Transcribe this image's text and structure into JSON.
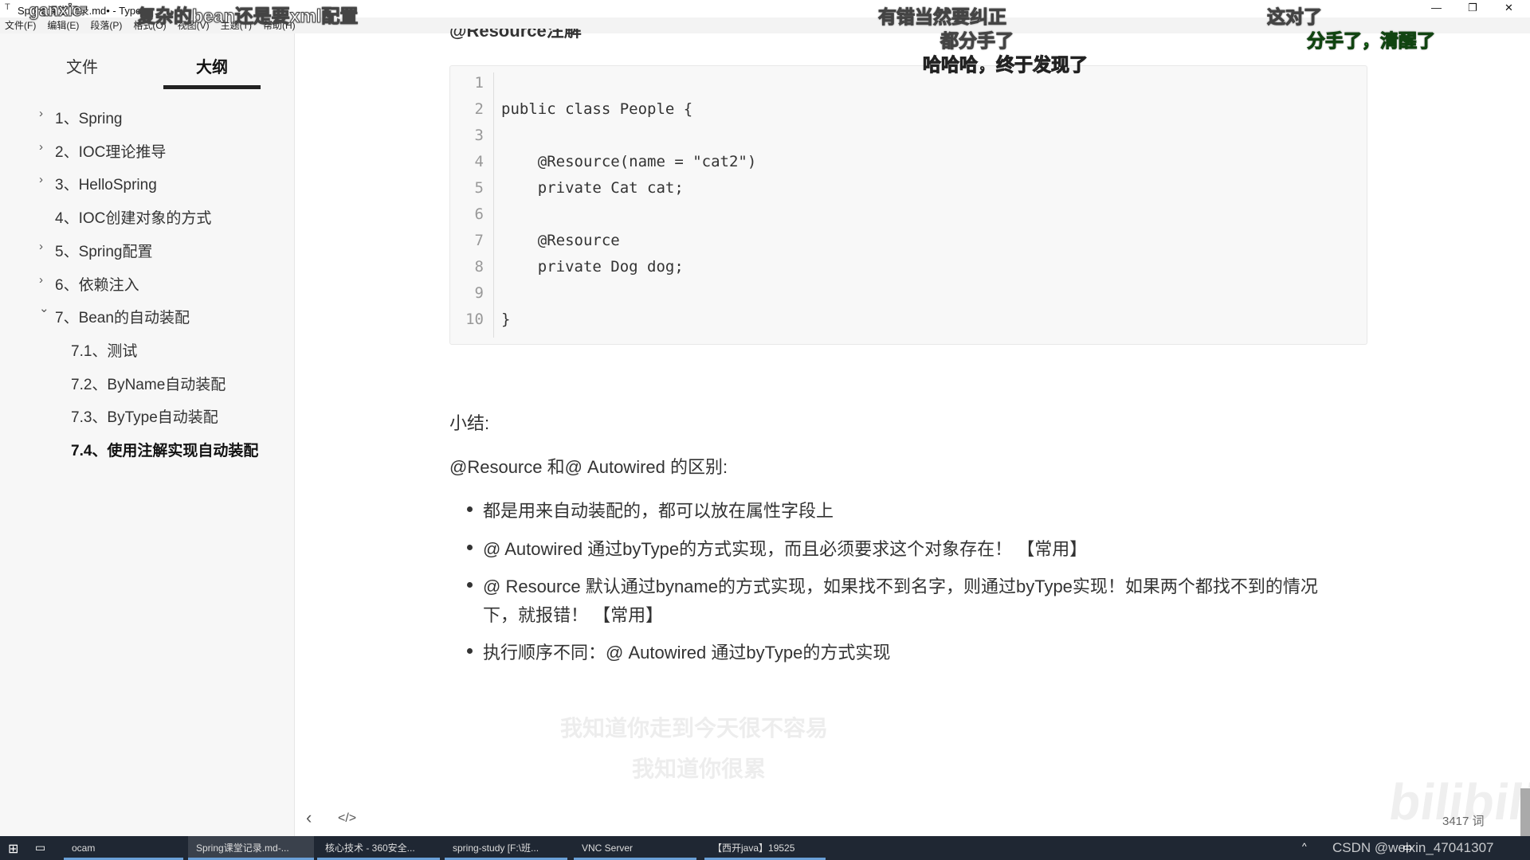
{
  "window": {
    "title": "Spring课堂记录.md• - Typora",
    "controls": [
      "—",
      "❐",
      "✕"
    ]
  },
  "menu": [
    "文件(F)",
    "编辑(E)",
    "段落(P)",
    "格式(O)",
    "视图(V)",
    "主题(T)",
    "帮助(H)"
  ],
  "sidebar": {
    "tabs": [
      "文件",
      "大纲"
    ],
    "active_tab": "大纲",
    "items": [
      {
        "label": "1、Spring",
        "arrow": "›",
        "level": 1
      },
      {
        "label": "2、IOC理论推导",
        "arrow": "›",
        "level": 1
      },
      {
        "label": "3、HelloSpring",
        "arrow": "›",
        "level": 1
      },
      {
        "label": "4、IOC创建对象的方式",
        "arrow": "",
        "level": 1
      },
      {
        "label": "5、Spring配置",
        "arrow": "›",
        "level": 1
      },
      {
        "label": "6、依赖注入",
        "arrow": "›",
        "level": 1
      },
      {
        "label": "7、Bean的自动装配",
        "arrow": "⌄",
        "level": 1
      },
      {
        "label": "7.1、测试",
        "arrow": "",
        "level": 2
      },
      {
        "label": "7.2、ByName自动装配",
        "arrow": "",
        "level": 2
      },
      {
        "label": "7.3、ByType自动装配",
        "arrow": "",
        "level": 2
      },
      {
        "label": "7.4、使用注解实现自动装配",
        "arrow": "",
        "level": 2,
        "active": true
      }
    ]
  },
  "content": {
    "heading": "@Resource注解",
    "code_lines": [
      "",
      "public class People {",
      "",
      "    @Resource(name = \"cat2\")",
      "    private Cat cat;",
      "",
      "    @Resource",
      "    private Dog dog;",
      "",
      "}"
    ],
    "summary_label": "小结:",
    "diff_title": "@Resource 和@ Autowired 的区别:",
    "bullets": [
      "都是用来自动装配的，都可以放在属性字段上",
      "@ Autowired  通过byType的方式实现，而且必须要求这个对象存在！ 【常用】",
      "@ Resource 默认通过byname的方式实现，如果找不到名字，则通过byType实现！如果两个都找不到的情况",
      "下，就报错！ 【常用】",
      "执行顺序不同：@ Autowired  通过byType的方式实现"
    ]
  },
  "footer": {
    "word_count": "3417 词",
    "back_icon": "‹",
    "source_icon": "</>"
  },
  "overlay": {
    "lyrics": [
      "我知道你走到今天很不容易",
      "我知道你很累"
    ],
    "danmaku": [
      {
        "text": "ganxie",
        "color": "#ffffff"
      },
      {
        "text": "复杂的bean还是要xml配置",
        "color": "#ffffff"
      },
      {
        "text": "有错当然要纠正",
        "color": "#ffffff"
      },
      {
        "text": "都分手了",
        "color": "#ffffff"
      },
      {
        "text": "哈哈哈，终于发现了",
        "color": "#ffffff"
      },
      {
        "text": "这对了",
        "color": "#ffffff"
      },
      {
        "text": "分手了，清醒了",
        "color": "#33cc33"
      }
    ],
    "watermark": "bilibili",
    "csdn": "CSDN @weixin_47041307"
  },
  "taskbar": {
    "items": [
      "ocam",
      "Spring课堂记录.md-...",
      "核心技术 - 360安全...",
      "spring-study [F:\\班...",
      "VNC Server",
      "【西开java】19525"
    ],
    "tray": [
      "^",
      "中"
    ]
  }
}
